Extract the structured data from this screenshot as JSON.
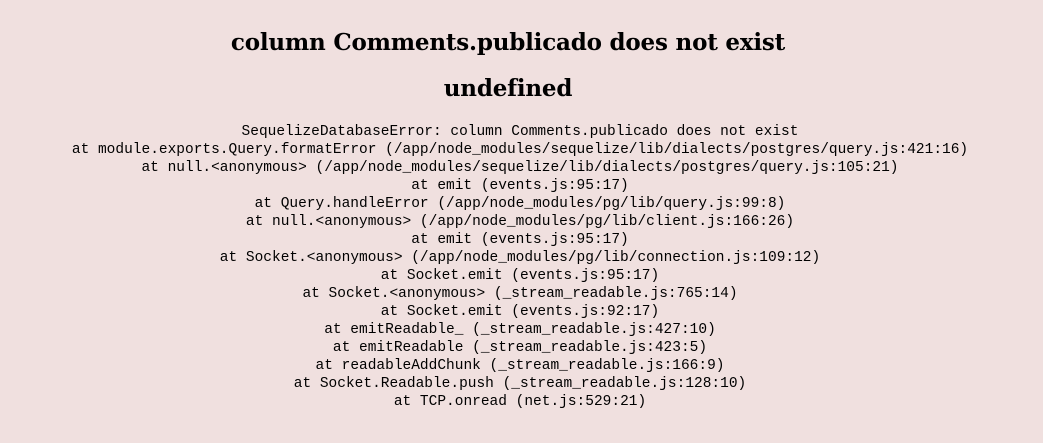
{
  "error": {
    "message": "column Comments.publicado does not exist",
    "status": "undefined",
    "stack": [
      "SequelizeDatabaseError: column Comments.publicado does not exist",
      "at module.exports.Query.formatError (/app/node_modules/sequelize/lib/dialects/postgres/query.js:421:16)",
      "at null.<anonymous> (/app/node_modules/sequelize/lib/dialects/postgres/query.js:105:21)",
      "at emit (events.js:95:17)",
      "at Query.handleError (/app/node_modules/pg/lib/query.js:99:8)",
      "at null.<anonymous> (/app/node_modules/pg/lib/client.js:166:26)",
      "at emit (events.js:95:17)",
      "at Socket.<anonymous> (/app/node_modules/pg/lib/connection.js:109:12)",
      "at Socket.emit (events.js:95:17)",
      "at Socket.<anonymous> (_stream_readable.js:765:14)",
      "at Socket.emit (events.js:92:17)",
      "at emitReadable_ (_stream_readable.js:427:10)",
      "at emitReadable (_stream_readable.js:423:5)",
      "at readableAddChunk (_stream_readable.js:166:9)",
      "at Socket.Readable.push (_stream_readable.js:128:10)",
      "at TCP.onread (net.js:529:21)"
    ]
  }
}
